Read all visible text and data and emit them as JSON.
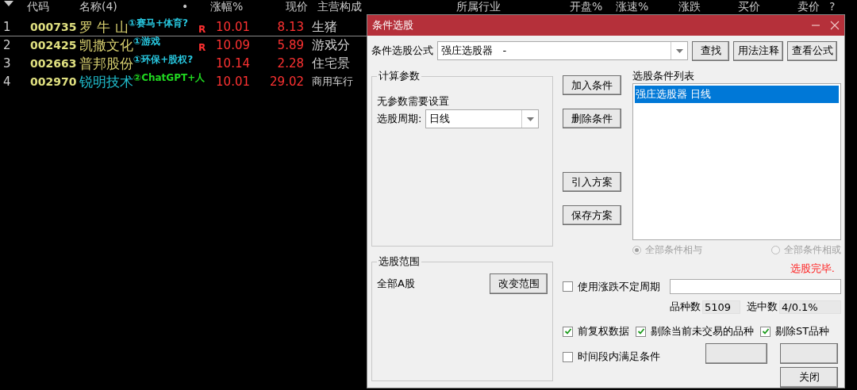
{
  "columns": [
    "代码",
    "名称(4)",
    "•",
    "涨幅%",
    "现价",
    "主营构成",
    "所属行业",
    "开盘%",
    "涨速%",
    "涨跌",
    "买价",
    "卖价",
    "?"
  ],
  "rows": [
    {
      "index": "1",
      "code": "000735",
      "name": {
        "text": "罗 牛 山",
        "color": "#d8d070"
      },
      "tag": {
        "text": "①赛马+体育?",
        "color": "#28c8e0"
      },
      "flag": "R",
      "change": "10.01",
      "price": "8.13",
      "business": "生猪",
      "selected": true
    },
    {
      "index": "2",
      "code": "002425",
      "name": {
        "text": "凯撒文化",
        "color": "#d8d070"
      },
      "tag": {
        "text": "①游戏",
        "color": "#28c8e0"
      },
      "flag": "R",
      "change": "10.09",
      "price": "5.89",
      "business": "游戏分",
      "selected": false
    },
    {
      "index": "3",
      "code": "002663",
      "name": {
        "text": "普邦股份",
        "color": "#d8d070"
      },
      "tag": {
        "text": "①环保+股权?",
        "color": "#28c8e0"
      },
      "change": "10.14",
      "price": "2.28",
      "business": "住宅景",
      "selected": false
    },
    {
      "index": "4",
      "code": "002970",
      "name": {
        "text": "锐明技术",
        "color": "#20c0d0"
      },
      "tag": {
        "text": "②ChatGPT+人",
        "color": "#20d820"
      },
      "change": "10.01",
      "price": "29.02",
      "business": "商用车行",
      "selected": false
    }
  ],
  "dialog": {
    "title": "条件选股",
    "formula": {
      "label": "条件选股公式",
      "value": "强庄选股器   -"
    },
    "top_buttons": [
      "查找",
      "用法注释",
      "查看公式"
    ],
    "params": {
      "title": "计算参数",
      "note": "无参数需要设置",
      "period_label": "选股周期:",
      "period_value": "日线"
    },
    "action_buttons": [
      "加入条件",
      "删除条件",
      "引入方案",
      "保存方案"
    ],
    "list": {
      "label": "选股条件列表",
      "items": [
        {
          "text": "强庄选股器  日线",
          "selected": true
        }
      ]
    },
    "logic": [
      {
        "label": "全部条件相与",
        "selected": true
      },
      {
        "label": "全部条件相或",
        "selected": false
      }
    ],
    "range": {
      "title": "选股范围",
      "value": "全部A股",
      "button": "改变范围"
    },
    "status": "选股完毕.",
    "variable_period": {
      "label": "使用涨跌不定周期",
      "checked": false
    },
    "counts": [
      {
        "label": "品种数",
        "value": "5109"
      },
      {
        "label": "选中数",
        "value": "4/0.1%"
      }
    ],
    "options": [
      {
        "label": "前复权数据",
        "checked": true
      },
      {
        "label": "剔除当前未交易的品种",
        "checked": true
      },
      {
        "label": "剔除ST品种",
        "checked": true
      }
    ],
    "time_condition": {
      "label": "时间段内满足条件",
      "checked": false
    },
    "close_button": "关闭"
  }
}
